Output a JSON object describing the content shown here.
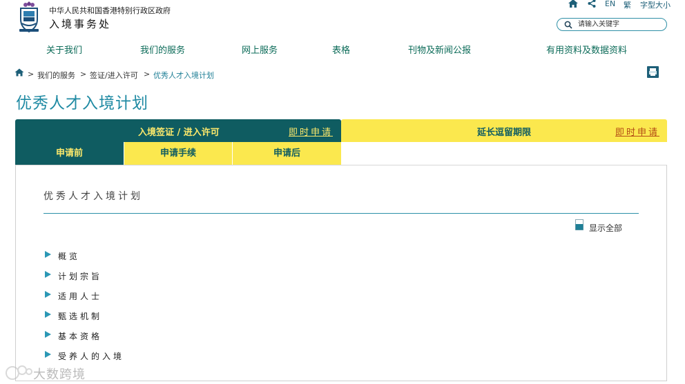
{
  "agency": {
    "line1": "中华人民共和国香港特别行政区政府",
    "line2": "入境事务处"
  },
  "utility": {
    "home_icon": "home-icon",
    "share_icon": "share-icon",
    "en": "EN",
    "trad": "繁",
    "font_size": "字型大小"
  },
  "search": {
    "placeholder": "请输入关键字"
  },
  "nav": {
    "items": [
      "关于我们",
      "我们的服务",
      "网上服务",
      "表格",
      "刊物及新闻公报",
      "有用资料及数据资料"
    ]
  },
  "breadcrumb": {
    "sep": ">",
    "items": [
      "我们的服务",
      "签证/进入许可",
      "优秀人才入境计划"
    ]
  },
  "page_title": "优秀人才入境计划",
  "tabs": {
    "entry": {
      "label": "入境签证 / 进入许可",
      "apply": "即时申请"
    },
    "extend": {
      "label": "延长逗留期限",
      "apply": "即时申请"
    }
  },
  "subtabs": [
    "申请前",
    "申请手续",
    "申请后"
  ],
  "section": {
    "heading": "优秀人才入境计划",
    "show_all": "显示全部",
    "accordion": [
      "概览",
      "计划宗旨",
      "适用人士",
      "甄选机制",
      "基本资格",
      "受养人的入境"
    ]
  },
  "watermark": {
    "text": "大数跨境"
  },
  "colors": {
    "teal_dark": "#0f5c61",
    "yellow": "#fbe84e",
    "title_blue": "#1f8aa3",
    "nav_green": "#0b6b58"
  }
}
